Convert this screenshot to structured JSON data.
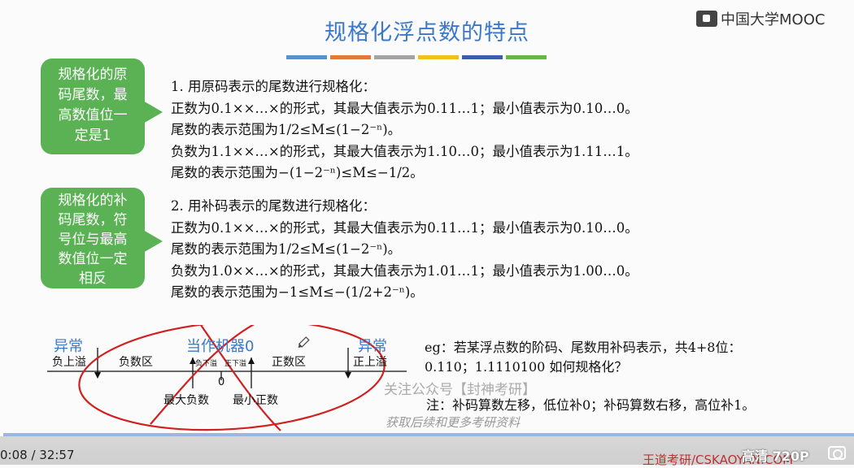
{
  "slide": {
    "title": "规格化浮点数的特点",
    "logo": "中国大学MOOC",
    "accent_bars": [
      "#5b8fc9",
      "#e07a3c",
      "#a3a3a3",
      "#eec21b",
      "#3a5fa8",
      "#6ab44a"
    ],
    "bubbles": [
      {
        "text": [
          "规格化的原",
          "码尾数，最",
          "高数值位一",
          "定是1"
        ]
      },
      {
        "text": [
          "规格化的补",
          "码尾数，符",
          "号位与最高",
          "数值位一定",
          "相反"
        ]
      }
    ],
    "sections": [
      {
        "lines": [
          "1. 用原码表示的尾数进行规格化：",
          "正数为0.1××…×的形式，其最大值表示为0.11…1；最小值表示为0.10…0。",
          "尾数的表示范围为1/2≤M≤(1−2⁻ⁿ)。",
          "负数为1.1××…×的形式，其最大值表示为1.10…0；最小值表示为1.11…1。",
          "尾数的表示范围为−(1−2⁻ⁿ)≤M≤−1/2。"
        ]
      },
      {
        "lines": [
          "2. 用补码表示的尾数进行规格化：",
          "正数为0.1××…×的形式，其最大值表示为0.11…1；最小值表示为0.10…0。",
          "尾数的表示范围为1/2≤M≤(1−2⁻ⁿ)。",
          "负数为1.0××…×的形式，其最大值表示为1.01…1；最小值表示为1.00…0。",
          "尾数的表示范围为−1≤M≤−(1/2+2⁻ⁿ)。"
        ]
      }
    ],
    "number_line": {
      "abnormal_left": "异常",
      "abnormal_right": "异常",
      "machine_zero": "当作机器0",
      "neg_overflow": "负上溢",
      "neg_region": "负数区",
      "neg_underflow": "负下溢",
      "pos_underflow": "正下溢",
      "pos_region": "正数区",
      "pos_overflow": "正上溢",
      "zero": "0",
      "max_negative": "最大负数",
      "min_positive": "最小正数"
    },
    "example": {
      "line1": "eg：若某浮点数的阶码、尾数用补码表示，共4+8位：",
      "line2": "0.110；1.1110100 如何规格化？"
    },
    "note": "注：补码算数左移，低位补0；补码算数右移，高位补1。",
    "watermark_1": "关注公众号【封神考研】",
    "watermark_2": "获取后续和更多考研资料"
  },
  "player": {
    "time": "0:08 / 32:57",
    "progress": 0.004,
    "quality": "高清 720P",
    "site": "王道考研/CSKAOYAN.COM"
  }
}
